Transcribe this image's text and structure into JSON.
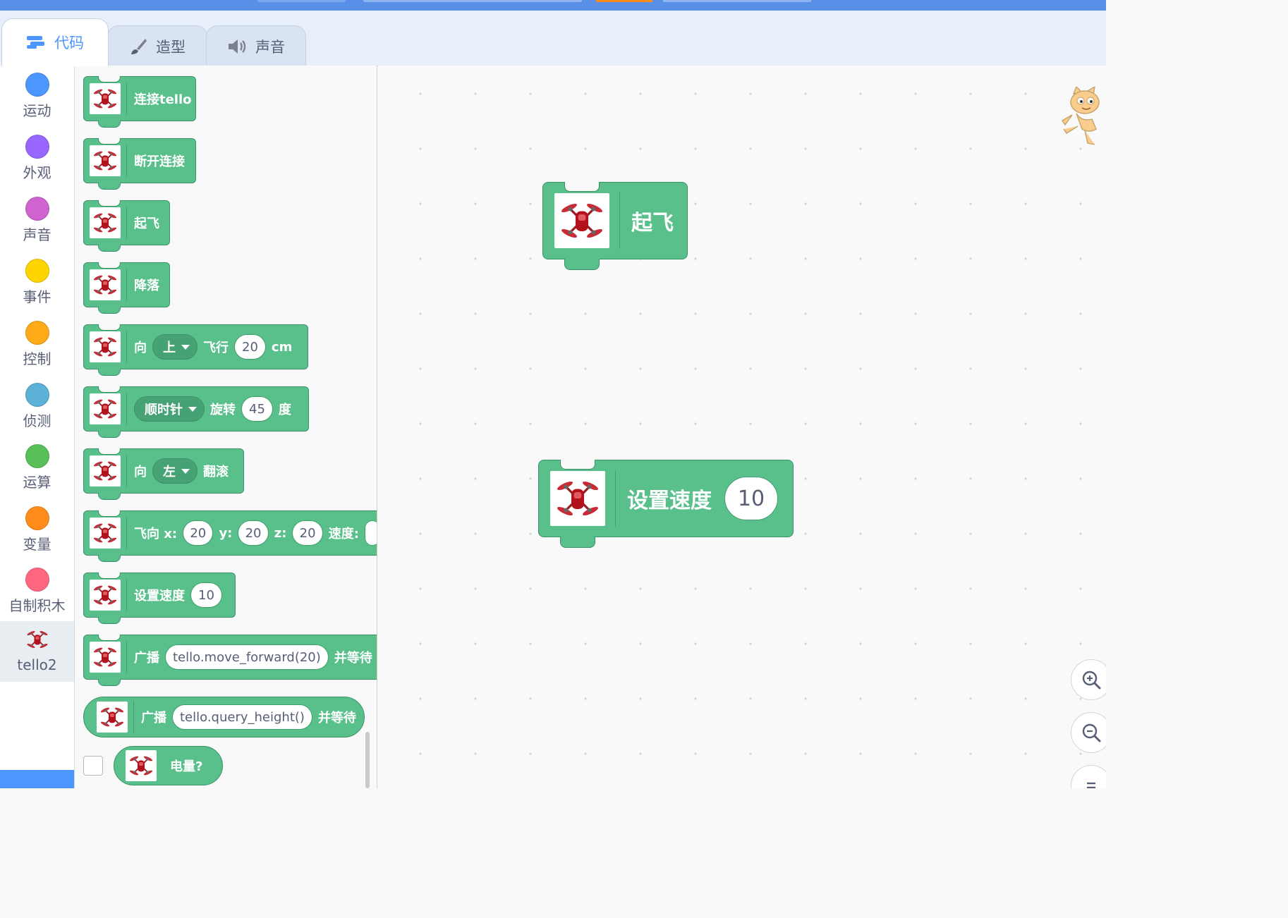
{
  "tabs": [
    {
      "label": "代码",
      "icon": "code-icon"
    },
    {
      "label": "造型",
      "icon": "paintbrush-icon"
    },
    {
      "label": "声音",
      "icon": "speaker-icon"
    }
  ],
  "categories": [
    {
      "label": "运动",
      "color": "#4c97ff"
    },
    {
      "label": "外观",
      "color": "#9966ff"
    },
    {
      "label": "声音",
      "color": "#cf63cf"
    },
    {
      "label": "事件",
      "color": "#ffd500"
    },
    {
      "label": "控制",
      "color": "#ffab19"
    },
    {
      "label": "侦测",
      "color": "#5cb1d6"
    },
    {
      "label": "运算",
      "color": "#59c059"
    },
    {
      "label": "变量",
      "color": "#ff8c1a"
    },
    {
      "label": "自制积木",
      "color": "#ff6680"
    },
    {
      "label": "tello2",
      "icon": "tello-drone-icon"
    }
  ],
  "palette": {
    "connect": "连接tello",
    "disconnect": "断开连接",
    "takeoff": "起飞",
    "land": "降落",
    "move": {
      "prefix": "向",
      "direction": "上",
      "mid": "飞行",
      "distance": "20",
      "unit": "cm"
    },
    "rotate": {
      "direction": "顺时针",
      "mid": "旋转",
      "angle": "45",
      "unit": "度"
    },
    "flip": {
      "prefix": "向",
      "direction": "左",
      "suffix": "翻滚"
    },
    "goto": {
      "label": "飞向 x:",
      "x": "20",
      "ylabel": "y:",
      "y": "20",
      "zlabel": "z:",
      "z": "20",
      "speed_label": "速度:"
    },
    "set_speed": {
      "label": "设置速度",
      "value": "10"
    },
    "broadcast": {
      "label": "广播",
      "command": "tello.move_forward(20)",
      "suffix": "并等待"
    },
    "broadcast_query": {
      "label": "广播",
      "command": "tello.query_height()",
      "suffix": "并等待"
    },
    "battery": "电量?"
  },
  "workspace": {
    "takeoff": "起飞",
    "set_speed": {
      "label": "设置速度",
      "value": "10"
    }
  },
  "colors": {
    "extension_green": "#59c08c",
    "accent_blue": "#4c97ff"
  }
}
